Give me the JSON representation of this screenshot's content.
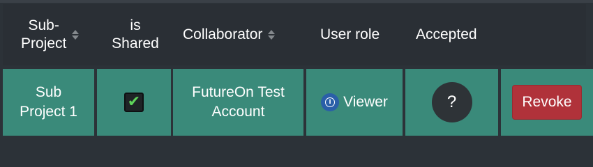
{
  "table": {
    "columns": [
      {
        "label": "Sub-\nProject",
        "sortable": true
      },
      {
        "label": "is\nShared",
        "sortable": false
      },
      {
        "label": "Collaborator",
        "sortable": true
      },
      {
        "label": "User role",
        "sortable": false
      },
      {
        "label": "Accepted",
        "sortable": false
      }
    ],
    "rows": [
      {
        "sub_project": "Sub\nProject 1",
        "is_shared": true,
        "collaborator": "FutureOn Test\nAccount",
        "user_role": "Viewer",
        "accepted": "?",
        "action_label": "Revoke"
      }
    ]
  },
  "icons": {
    "checkbox": "checkmark-icon",
    "role_info": "info-icon",
    "sort": "sort-icon"
  },
  "colors": {
    "header_bg": "#2a2f35",
    "row_bg": "#3a8a7a",
    "revoke_bg": "#b0323a",
    "question_bg": "#2e3337",
    "info_bg": "#2a5fa8",
    "check": "#5fd35a"
  }
}
